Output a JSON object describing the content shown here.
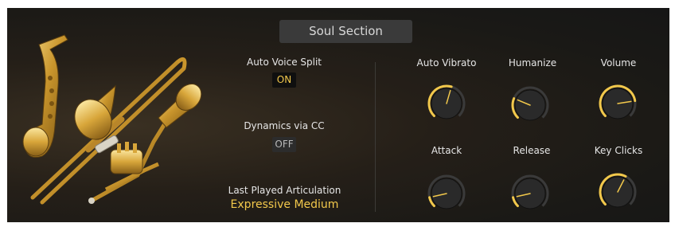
{
  "preset": {
    "title": "Soul Section"
  },
  "controls": {
    "auto_voice_split": {
      "label": "Auto Voice Split",
      "value": "ON"
    },
    "dynamics_via_cc": {
      "label": "Dynamics via CC",
      "value": "OFF"
    },
    "last_played_articulation": {
      "label": "Last Played Articulation",
      "value": "Expressive Medium"
    }
  },
  "knobs": [
    {
      "id": "auto-vibrato",
      "label": "Auto Vibrato",
      "level": 0.56
    },
    {
      "id": "humanize",
      "label": "Humanize",
      "level": 0.25
    },
    {
      "id": "volume",
      "label": "Volume",
      "level": 0.8
    },
    {
      "id": "attack",
      "label": "Attack",
      "level": 0.12
    },
    {
      "id": "release",
      "label": "Release",
      "level": 0.12
    },
    {
      "id": "key-clicks",
      "label": "Key Clicks",
      "level": 0.6
    }
  ],
  "colors": {
    "accent": "#f2c84b",
    "panel_bg": "#1a1916",
    "knob_body": "#2a2a2a",
    "knob_track": "#3a3a3a"
  },
  "icons": {
    "instruments_image": "saxophone-trombone-trumpet-icon"
  }
}
